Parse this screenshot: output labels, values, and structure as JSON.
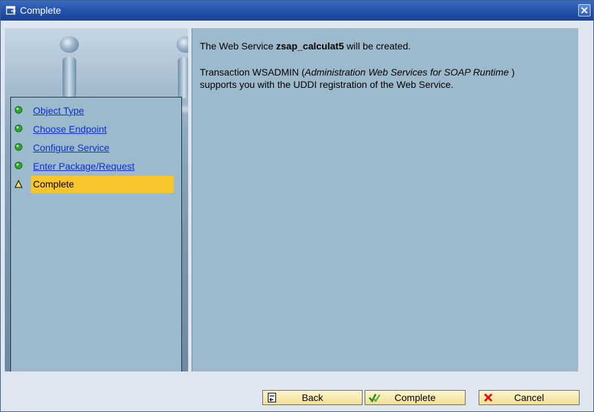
{
  "window": {
    "title": "Complete"
  },
  "steps": [
    {
      "label": "Object Type",
      "status": "done"
    },
    {
      "label": "Choose Endpoint",
      "status": "done"
    },
    {
      "label": "Configure Service",
      "status": "done"
    },
    {
      "label": "Enter Package/Request",
      "status": "done"
    },
    {
      "label": "Complete",
      "status": "current"
    }
  ],
  "content": {
    "line1_prefix": "The Web Service ",
    "service_name": "zsap_calculat5",
    "line1_suffix": " will be created.",
    "line2_prefix": "Transaction WSADMIN (",
    "line2_italic": "Administration Web Services for SOAP Runtime",
    "line2_suffix": " )",
    "line3": "supports you with the UDDI registration of the Web Service."
  },
  "buttons": {
    "back_label": "Back",
    "complete_label": "Complete",
    "cancel_label": "Cancel"
  },
  "colors": {
    "titlebar": "#2654ad",
    "panel_bg": "#9dbacc",
    "highlight": "#f8c52b",
    "link": "#0a2fd0",
    "done_bullet": "#2fa82f",
    "current_bullet": "#f3e24a"
  }
}
